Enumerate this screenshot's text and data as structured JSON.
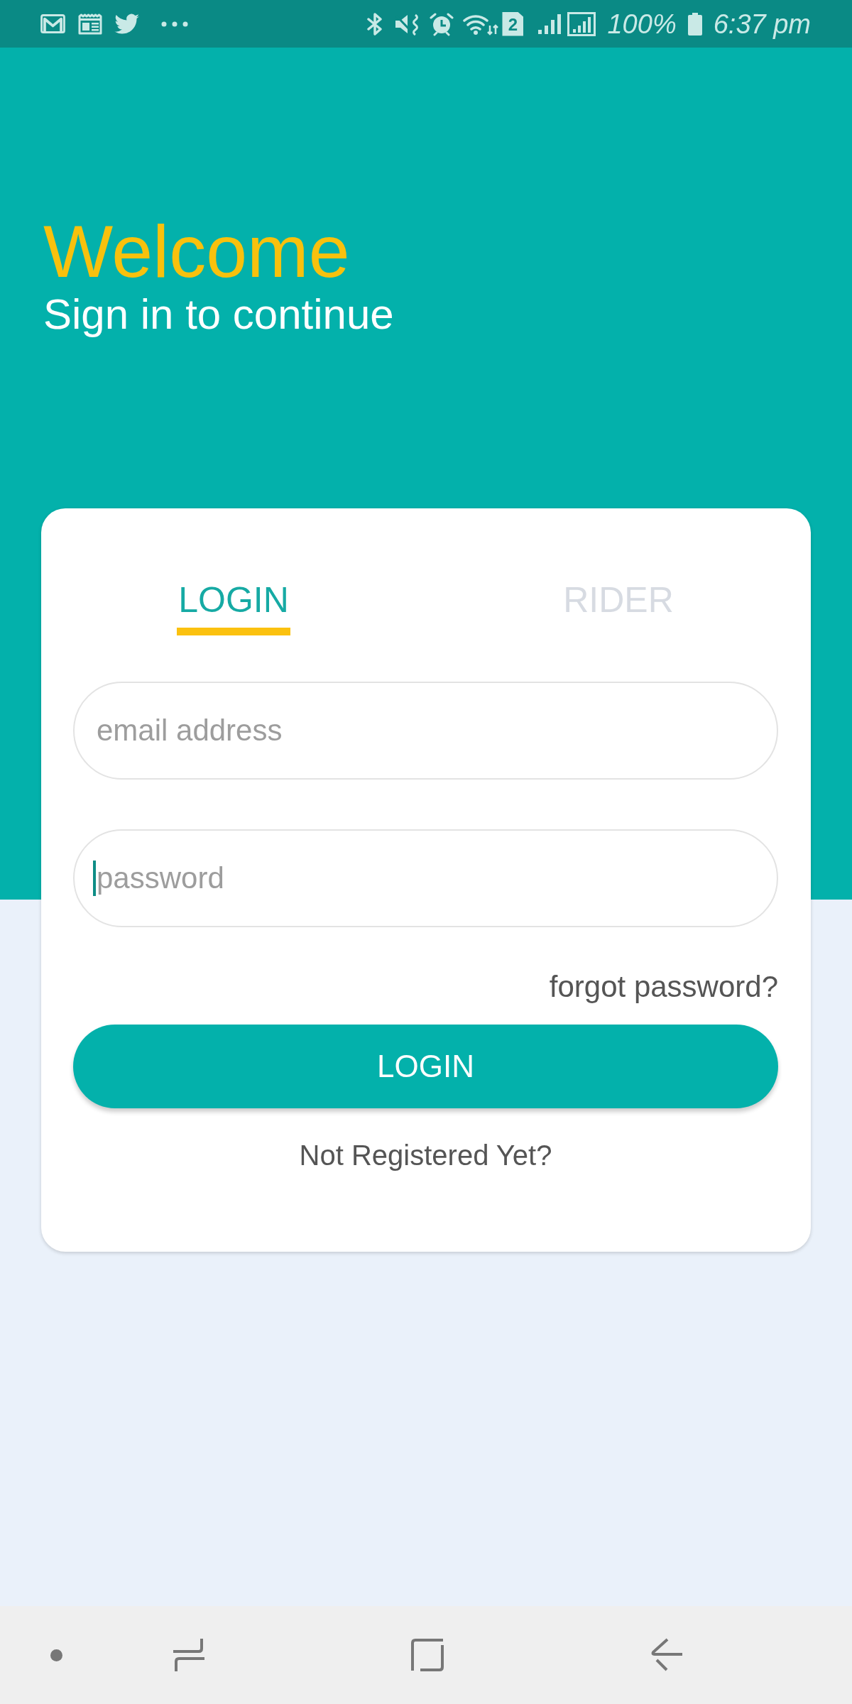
{
  "status_bar": {
    "sim_label": "2",
    "battery": "100%",
    "time": "6:37 pm"
  },
  "header": {
    "title": "Welcome",
    "subtitle": "Sign in to continue"
  },
  "tabs": [
    {
      "label": "LOGIN",
      "selected": true
    },
    {
      "label": "RIDER",
      "selected": false
    }
  ],
  "fields": [
    {
      "placeholder": "email address",
      "focused": false
    },
    {
      "placeholder": "password",
      "focused": true
    }
  ],
  "forgot_link": "forgot password?",
  "login_button": "LOGIN",
  "register_link": "Not Registered Yet?"
}
